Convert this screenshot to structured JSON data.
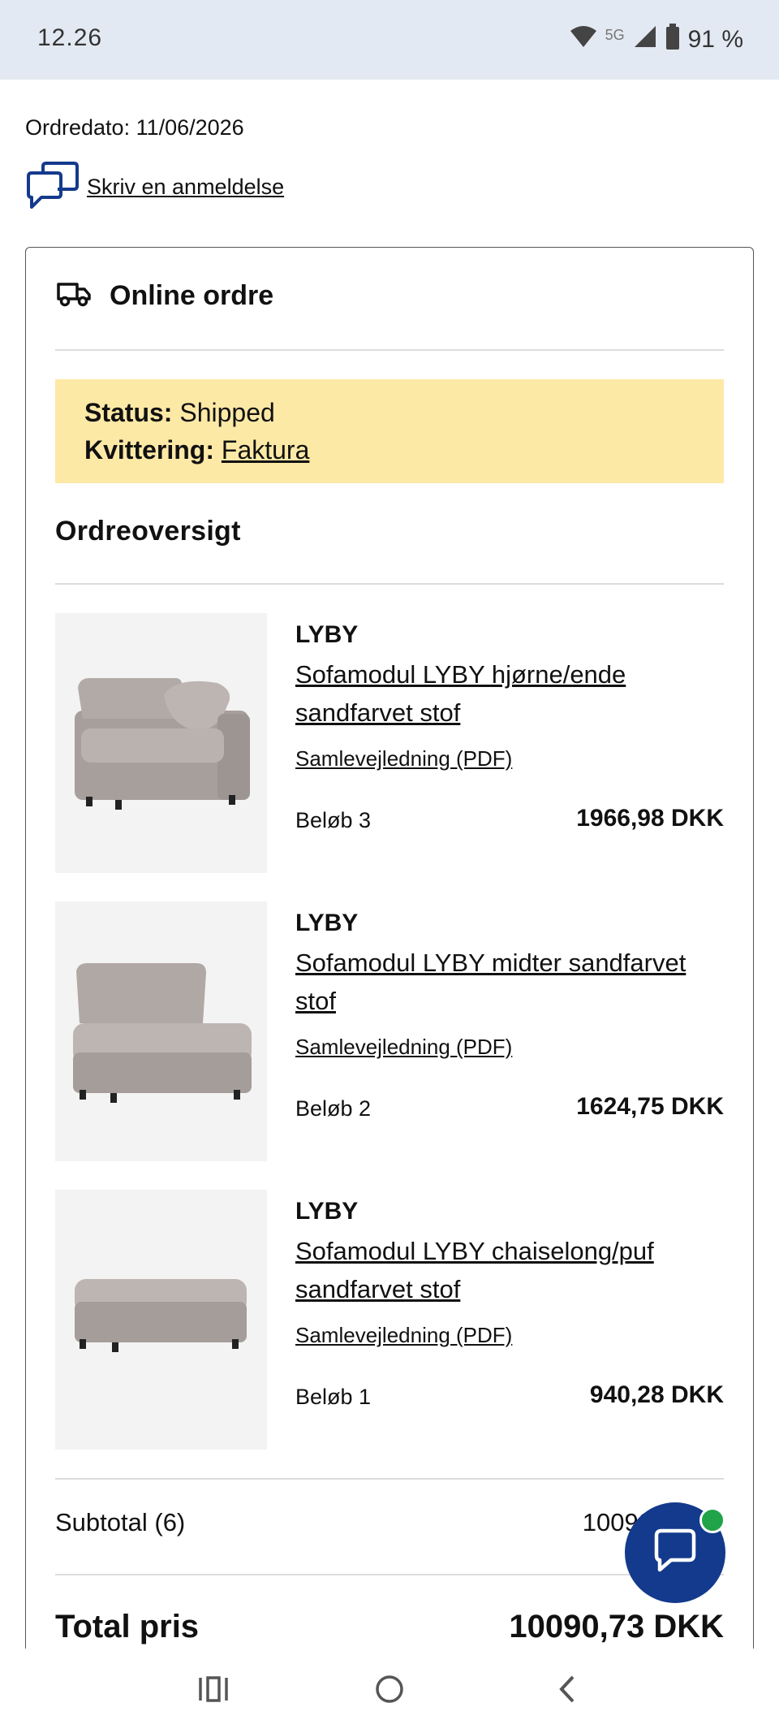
{
  "status_bar": {
    "time": "12.26",
    "network": "5G",
    "battery": "91 %"
  },
  "order": {
    "date": "Ordredato: 11/06/2026",
    "review_label": "Skriv en anmeldelse"
  },
  "card": {
    "title": "Online ordre",
    "status_label": "Status:",
    "status_value": "Shipped",
    "receipt_label": "Kvittering:",
    "receipt_link": "Faktura",
    "overview_title": "Ordreoversigt"
  },
  "items": [
    {
      "brand": "LYBY",
      "name": "Sofamodul LYBY hjørne/ende sandfarvet stof",
      "manual": "Samlevejledning (PDF)",
      "qty": "Beløb 3",
      "price": "1966,98 DKK"
    },
    {
      "brand": "LYBY",
      "name": "Sofamodul LYBY midter sandfarvet stof",
      "manual": "Samlevejledning (PDF)",
      "qty": "Beløb 2",
      "price": "1624,75 DKK"
    },
    {
      "brand": "LYBY",
      "name": "Sofamodul LYBY chaiselong/puf sandfarvet stof",
      "manual": "Samlevejledning (PDF)",
      "qty": "Beløb 1",
      "price": "940,28 DKK"
    }
  ],
  "summary": {
    "subtotal_label": "Subtotal (6)",
    "subtotal_value": "10090",
    "total_label": "Total pris",
    "total_value": "10090,73 DKK"
  },
  "colors": {
    "status_bg": "#fde9a6",
    "chat_button": "#133a8c",
    "online_dot": "#21a34a",
    "statusbar_bg": "#e3e9f2"
  },
  "icons": {
    "review": "chat-bubbles-icon",
    "delivery": "truck-icon",
    "chat": "chat-bubble-icon"
  }
}
